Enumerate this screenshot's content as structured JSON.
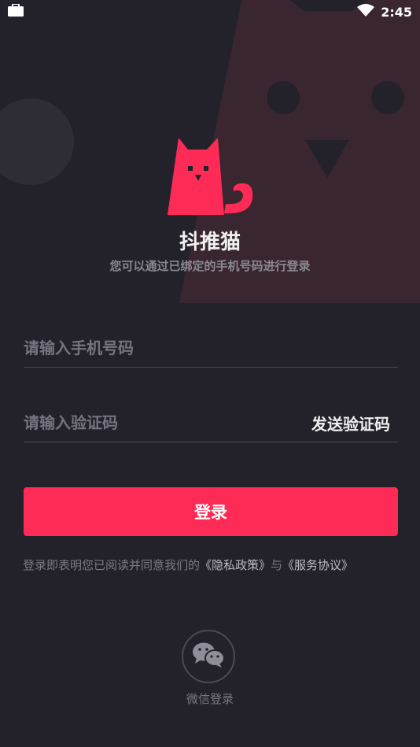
{
  "status_bar": {
    "time": "2:45"
  },
  "app": {
    "name": "抖推猫",
    "subtitle": "您可以通过已绑定的手机号码进行登录"
  },
  "form": {
    "phone_placeholder": "请输入手机号码",
    "code_placeholder": "请输入验证码",
    "send_code_label": "发送验证码",
    "login_label": "登录"
  },
  "agreement": {
    "prefix": "登录即表明您已阅读并同意我们的",
    "privacy_link": "《隐私政策》",
    "conjunction": "与",
    "terms_link": "《服务协议》"
  },
  "wechat": {
    "label": "微信登录"
  },
  "colors": {
    "accent": "#fd2b55",
    "background": "#23222b"
  }
}
